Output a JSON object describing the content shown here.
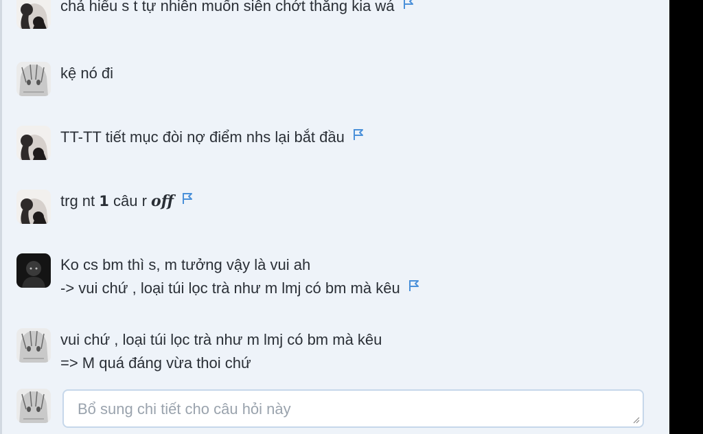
{
  "comments": [
    {
      "avatar": "girl-portrait-avatar",
      "lines": [
        "chả hiểu s t tự nhiên muốn siên chớt thằng kia wá"
      ],
      "flag": true
    },
    {
      "avatar": "anime-sketch-avatar",
      "lines": [
        "kệ nó đi"
      ],
      "flag": false
    },
    {
      "avatar": "girl-portrait-avatar",
      "lines": [
        "TT-TT tiết mục đòi nợ điểm nhs lại bắt đầu"
      ],
      "flag": true
    },
    {
      "avatar": "girl-portrait-avatar",
      "line_parts": {
        "a": "trg nt ",
        "num": "1",
        "b": " câu r ",
        "math": "off"
      },
      "flag": true
    },
    {
      "avatar": "dark-figure-avatar",
      "lines": [
        "Ko cs bm thì s, m tưởng vậy là vui ah",
        "-> vui chứ , loại túi lọc trà như m lmj có bm mà kêu"
      ],
      "flag": true
    },
    {
      "avatar": "anime-sketch-avatar",
      "lines": [
        "vui chứ , loại túi lọc trà như m lmj có bm mà kêu",
        "=> M quá đáng vừa thoi chứ"
      ],
      "flag": false
    }
  ],
  "reply": {
    "avatar": "anime-sketch-avatar",
    "placeholder": "Bổ sung chi tiết cho câu hỏi này",
    "value": ""
  },
  "colors": {
    "background": "#eef3f9",
    "text": "#2a2f36",
    "flag": "#4a90d9",
    "input_border": "#c6d7ea"
  }
}
